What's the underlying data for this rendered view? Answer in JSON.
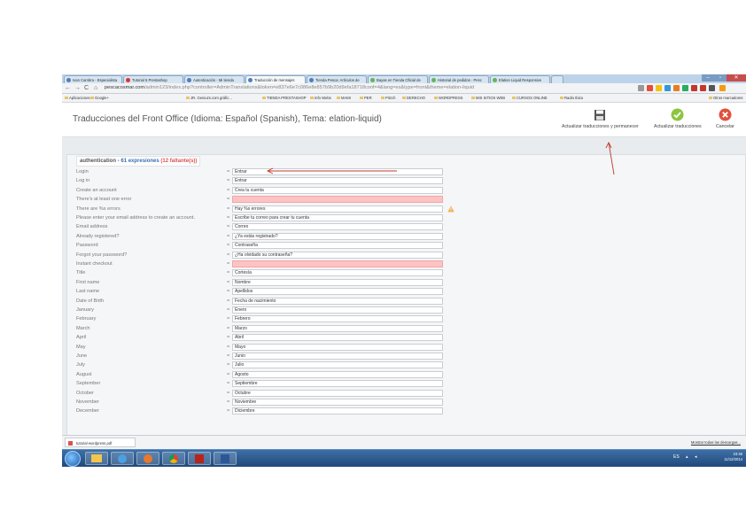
{
  "browser": {
    "tabs": [
      {
        "label": "Ivan Cambra - Especialista",
        "active": false
      },
      {
        "label": "Tutorial 5 Prestashop",
        "active": false
      },
      {
        "label": "Autenticación - Mi tienda",
        "active": false
      },
      {
        "label": "Traducción de mensajes",
        "active": true
      },
      {
        "label": "Tienda Pesca: Artículos de",
        "active": false
      },
      {
        "label": "Bayas en Tienda Oficial de",
        "active": false
      },
      {
        "label": "Historial de pedidos - Pesc",
        "active": false
      },
      {
        "label": "Elation Liquid Responsive",
        "active": false
      }
    ],
    "url_host": "pescacosmar.com",
    "url_path": "/admin123/index.php?controller=AdminTranslations&token=e837e6e7c086e8e857b9b20d9efa18718conf=4&lang=es&type=front&theme=elation-liquid",
    "bookmarks": [
      "Aplicaciones",
      "Google+",
      "JR. Geniuzs.com gráfic...",
      "TIENDA PRESTASHOP",
      "Info Webs",
      "MAMI",
      "PER",
      "Pitzch",
      "DERECHO",
      "WORDPRESS",
      "MIS SITIOS WEB",
      "CURSOS ONLINE",
      "Radio Ibiza",
      "Otros marcadores"
    ]
  },
  "header": {
    "title": "Traducciones del Front Office (Idioma: Español (Spanish), Tema: elation-liquid)",
    "save_stay_label": "Actualizar traducciones y permanecer",
    "save_label": "Actualizar traducciones",
    "cancel_label": "Cancelar"
  },
  "panel": {
    "section": "authentication",
    "count_text": "61 expresiones",
    "missing_text": "(12 faltante(s))",
    "rows": [
      {
        "label": "Login",
        "value": "Entrar"
      },
      {
        "label": "Log in",
        "value": "Entrar"
      },
      {
        "label": "Create an account",
        "value": "Crea tu cuenta"
      },
      {
        "label": "There's at least one error",
        "value": ""
      },
      {
        "label": "There are %s errors",
        "value": "Hay %s errores"
      },
      {
        "label": "Please enter your email address to create an account.",
        "value": "Escribe tu correo para crear tu cuenta"
      },
      {
        "label": "Email address",
        "value": "Correo"
      },
      {
        "label": "Already registered?",
        "value": "¿Ya estás registrado?"
      },
      {
        "label": "Password",
        "value": "Contraseña"
      },
      {
        "label": "Forgot your password?",
        "value": "¿Ha olvidado su contraseña?"
      },
      {
        "label": "Instant checkout",
        "value": ""
      },
      {
        "label": "Title",
        "value": "Cortesía"
      },
      {
        "label": "First name",
        "value": "Nombre"
      },
      {
        "label": "Last name",
        "value": "Apellidos"
      },
      {
        "label": "Date of Birth",
        "value": "Fecha de nacimiento"
      },
      {
        "label": "January",
        "value": "Enero"
      },
      {
        "label": "February",
        "value": "Febrero"
      },
      {
        "label": "March",
        "value": "Marzo"
      },
      {
        "label": "April",
        "value": "Abril"
      },
      {
        "label": "May",
        "value": "Mayo"
      },
      {
        "label": "June",
        "value": "Junio"
      },
      {
        "label": "July",
        "value": "Julio"
      },
      {
        "label": "August",
        "value": "Agosto"
      },
      {
        "label": "September",
        "value": "Septiembre"
      },
      {
        "label": "October",
        "value": "Octubre"
      },
      {
        "label": "November",
        "value": "Noviembre"
      },
      {
        "label": "December",
        "value": "Diciembre"
      }
    ]
  },
  "downloads": {
    "file": "tutorial-wordpress.pdf",
    "show_all": "Mostrar todas las descargas..."
  },
  "taskbar": {
    "language": "ES",
    "time": "23:46",
    "date": "11/12/2014"
  },
  "colors": {
    "missing_bg": "#ffc2c2",
    "accent": "#3a6fb0",
    "annotation_red": "#c0392b"
  }
}
